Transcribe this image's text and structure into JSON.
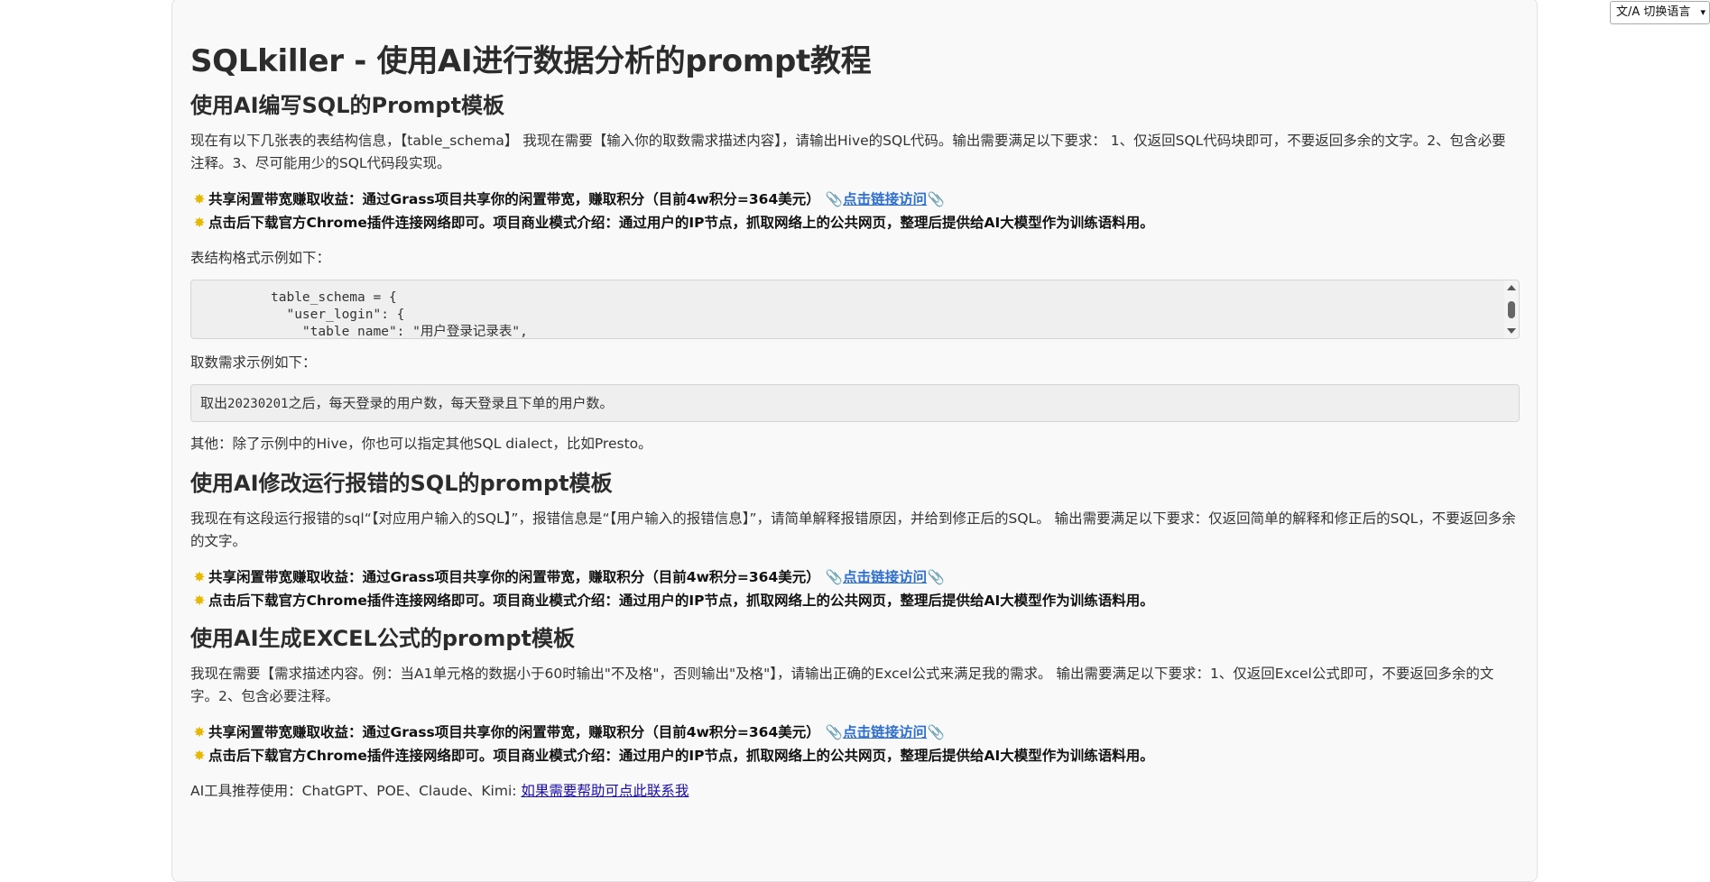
{
  "language_selector": {
    "label": "文/A 切换语言",
    "chevron": "chevron-down-icon"
  },
  "page_title": "SQLkiller - 使用AI进行数据分析的prompt教程",
  "promo": {
    "line1": "共享闲置带宽赚取收益：通过Grass项目共享你的闲置带宽，赚取积分（目前4w积分=364美元）",
    "link": "点击链接访问",
    "line2": "点击后下载官方Chrome插件连接网络即可。项目商业模式介绍：通过用户的IP节点，抓取网络上的公共网页，整理后提供给AI大模型作为训练语料用。",
    "star_icon": "sparkle-icon",
    "clip_icon": "paperclip-icon"
  },
  "section_sql": {
    "heading": "使用AI编写SQL的Prompt模板",
    "body": "现在有以下几张表的表结构信息，【table_schema】 我现在需要【输入你的取数需求描述内容】，请输出Hive的SQL代码。输出需要满足以下要求： 1、仅返回SQL代码块即可，不要返回多余的文字。2、包含必要注释。3、尽可能用少的SQL代码段实现。",
    "schema_label": "表结构格式示例如下：",
    "code_lines": [
      "table_schema = {",
      "  \"user_login\": {",
      "    \"table_name\": \"用户登录记录表\","
    ],
    "example_label": "取数需求示例如下：",
    "example_prefix": "取出",
    "example_date": "20230201",
    "example_suffix": "之后，每天登录的用户数，每天登录且下单的用户数。",
    "other_note": "其他：除了示例中的Hive，你也可以指定其他SQL dialect，比如Presto。"
  },
  "section_fix": {
    "heading": "使用AI修改运行报错的SQL的prompt模板",
    "body": "我现在有这段运行报错的sql“【对应用户输入的SQL】”，报错信息是“【用户输入的报错信息】”，请简单解释报错原因，并给到修正后的SQL。 输出需要满足以下要求：仅返回简单的解释和修正后的SQL，不要返回多余的文字。"
  },
  "section_excel": {
    "heading": "使用AI生成EXCEL公式的prompt模板",
    "body": "我现在需要【需求描述内容。例：当A1单元格的数据小于60时输出\"不及格\"，否则输出\"及格\"】，请输出正确的Excel公式来满足我的需求。 输出需要满足以下要求：1、仅返回Excel公式即可，不要返回多余的文字。2、包含必要注释。"
  },
  "footer": {
    "tools": "AI工具推荐使用：ChatGPT、POE、Claude、Kimi: ",
    "contact_link": "如果需要帮助可点此联系我"
  }
}
